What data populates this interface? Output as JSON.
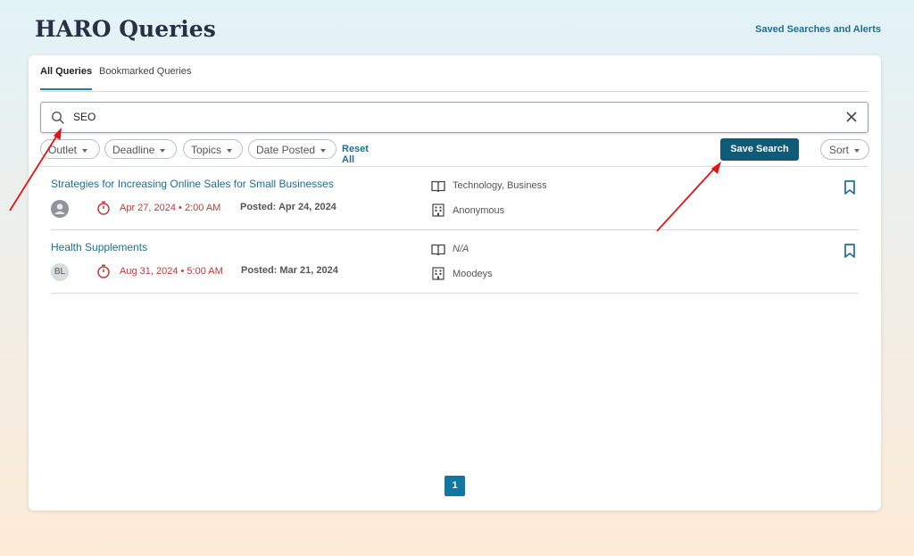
{
  "header": {
    "title": "HARO Queries",
    "saved_searches_link": "Saved Searches and Alerts"
  },
  "tabs": [
    {
      "label": "All Queries",
      "active": true
    },
    {
      "label": "Bookmarked Queries",
      "active": false
    }
  ],
  "search": {
    "value": "SEO",
    "icon": "search-icon",
    "clear_icon": "close-icon"
  },
  "filters": {
    "pills": [
      "Outlet",
      "Deadline",
      "Topics",
      "Date Posted"
    ],
    "reset_label": "Reset All",
    "save_search_label": "Save Search",
    "sort_label": "Sort"
  },
  "queries": [
    {
      "title": "Strategies for Increasing Online Sales for Small Businesses",
      "avatar": "",
      "avatar_icon": "user-icon",
      "deadline": "Apr 27, 2024  •  2:00 AM",
      "posted": "Posted: Apr 24, 2024",
      "topics": "Technology, Business",
      "organization": "Anonymous"
    },
    {
      "title": "Health Supplements",
      "avatar": "BL",
      "deadline": "Aug 31, 2024  •  5:00 AM",
      "posted": "Posted: Mar 21, 2024",
      "topics": "N/A",
      "organization": "Moodeys"
    }
  ],
  "pagination": {
    "current_page": "1"
  },
  "colors": {
    "accent": "#1d6f93",
    "button": "#0d5b78",
    "deadline": "#c83737",
    "annotation_arrow": "#e01515"
  }
}
